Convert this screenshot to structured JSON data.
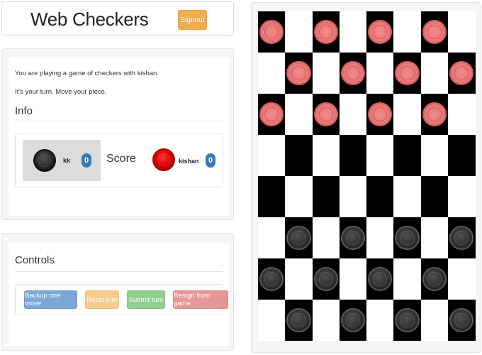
{
  "header": {
    "title": "Web Checkers",
    "signout_label": "Signout"
  },
  "info": {
    "message": "You are playing a game of checkers with kishan.",
    "turn_message": "It's your turn. Move your piece.",
    "title": "Info",
    "score_label": "Score",
    "me": {
      "name": "kk",
      "score": "0",
      "piece_color": "black"
    },
    "opponent": {
      "name": "kishan",
      "score": "0",
      "piece_color": "red"
    }
  },
  "controls": {
    "title": "Controls",
    "backup_label": "Backup one move",
    "reset_label": "Reset turn",
    "submit_label": "Submit turn",
    "resign_label": "Resign from game"
  },
  "board": {
    "rows": 8,
    "cols": 8,
    "colors": {
      "dark": "#000000",
      "light": "#ffffff",
      "red_piece": "#e97878",
      "black_piece": "#2a2a2a"
    },
    "pieces": [
      [
        "R",
        null,
        "R",
        null,
        "R",
        null,
        "R",
        null
      ],
      [
        null,
        "R",
        null,
        "R",
        null,
        "R",
        null,
        "R"
      ],
      [
        "R",
        null,
        "R",
        null,
        "R",
        null,
        "R",
        null
      ],
      [
        null,
        null,
        null,
        null,
        null,
        null,
        null,
        null
      ],
      [
        null,
        null,
        null,
        null,
        null,
        null,
        null,
        null
      ],
      [
        null,
        "B",
        null,
        "B",
        null,
        "B",
        null,
        "B"
      ],
      [
        "B",
        null,
        "B",
        null,
        "B",
        null,
        "B",
        null
      ],
      [
        null,
        "B",
        null,
        "B",
        null,
        "B",
        null,
        "B"
      ]
    ]
  }
}
